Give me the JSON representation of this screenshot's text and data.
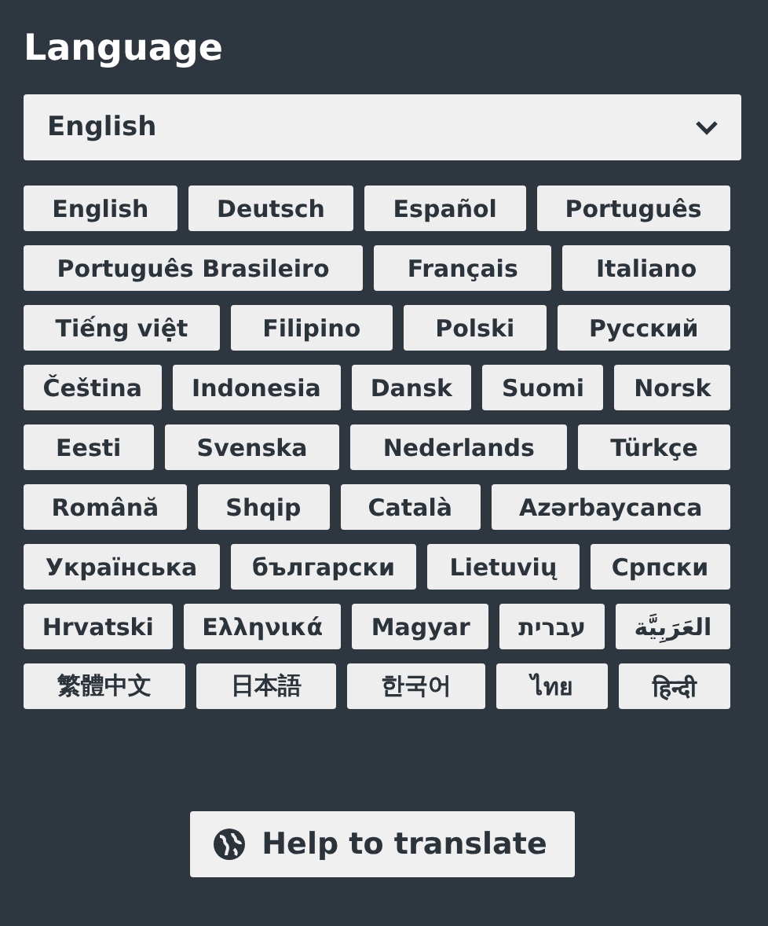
{
  "title": "Language",
  "select": {
    "value": "English"
  },
  "language_rows": [
    [
      "English",
      "Deutsch",
      "Español",
      "Português"
    ],
    [
      "Português Brasileiro",
      "Français",
      "Italiano"
    ],
    [
      "Tiếng việt",
      "Filipino",
      "Polski",
      "Русский"
    ],
    [
      "Čeština",
      "Indonesia",
      "Dansk",
      "Suomi",
      "Norsk"
    ],
    [
      "Eesti",
      "Svenska",
      "Nederlands",
      "Türkçe"
    ],
    [
      "Română",
      "Shqip",
      "Català",
      "Azərbaycanca"
    ],
    [
      "Українська",
      "български",
      "Lietuvių",
      "Српски"
    ],
    [
      "Hrvatski",
      "Ελληνικά",
      "Magyar",
      "עברית",
      "العَرَبِيَّة"
    ],
    [
      "繁體中文",
      "日本語",
      "한국어",
      "ไทย",
      "हिन्दी"
    ]
  ],
  "help_button": "Help to translate"
}
